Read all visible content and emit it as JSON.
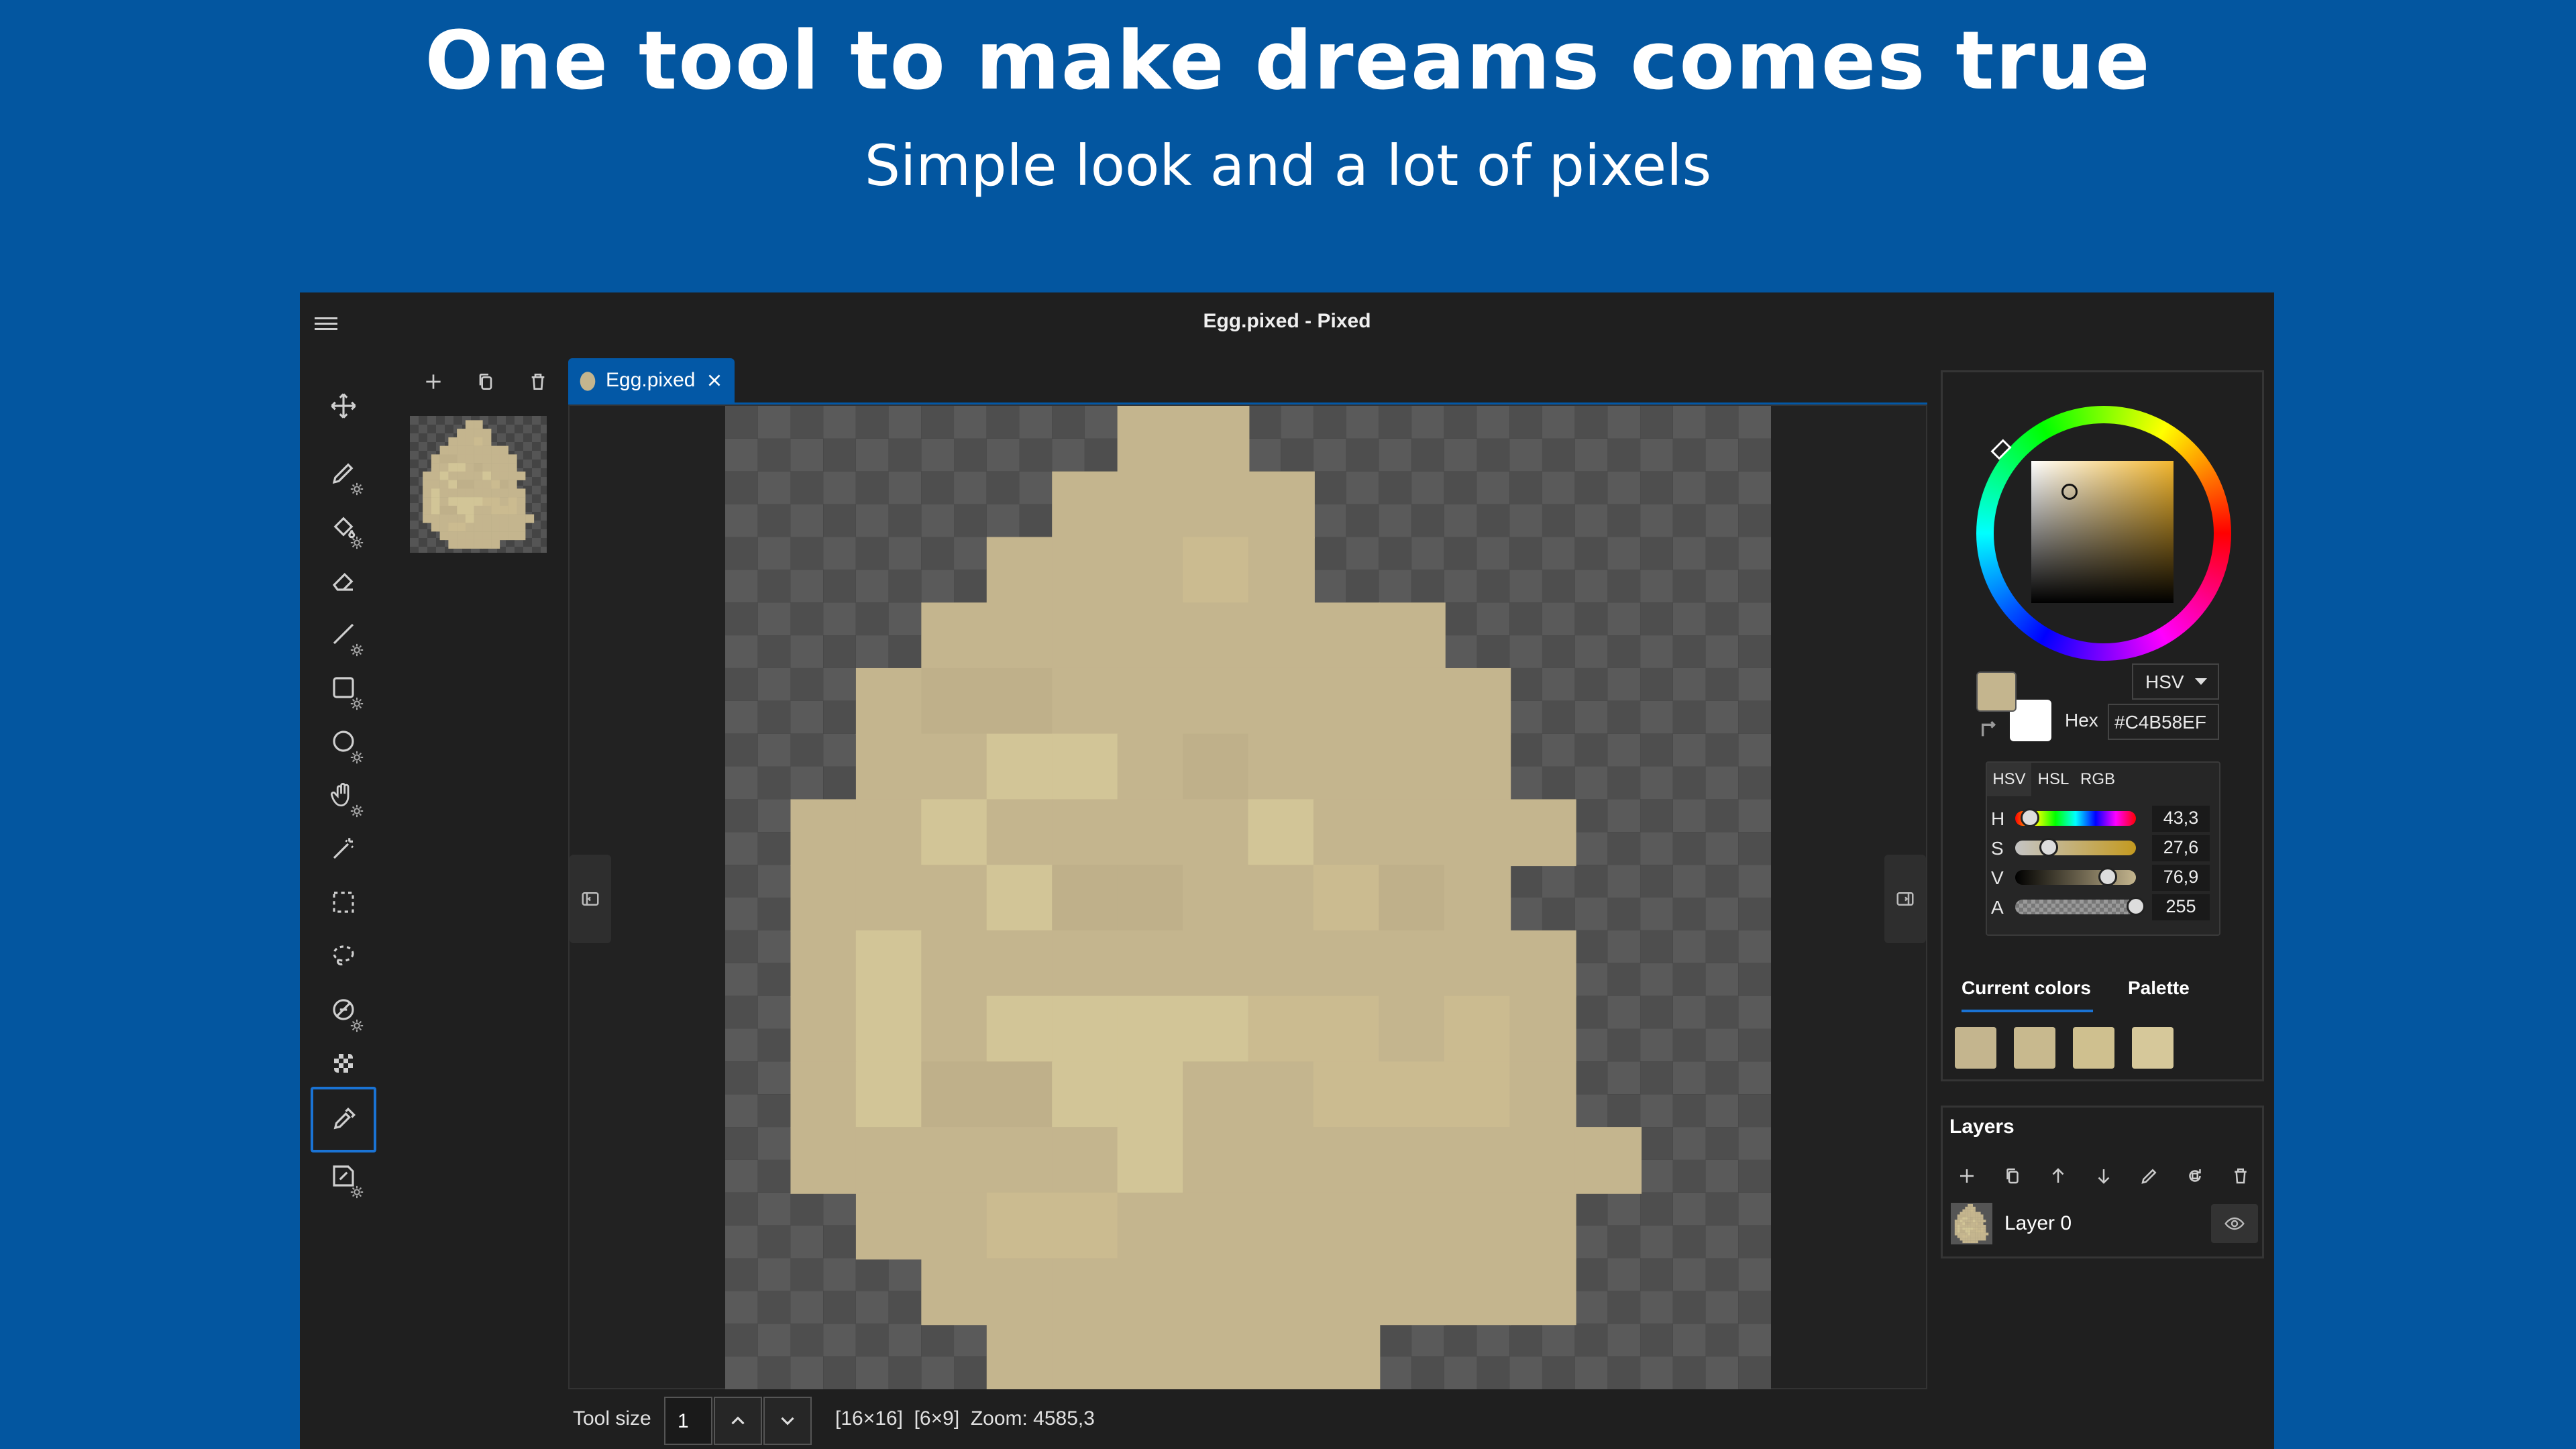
{
  "promo": {
    "headline": "One tool to make dreams comes true",
    "subheadline": "Simple look and a lot of pixels"
  },
  "window": {
    "title": "Egg.pixed - Pixed"
  },
  "toolbar": {
    "tools": [
      {
        "name": "move",
        "icon": "move-icon",
        "has_settings": false
      },
      {
        "name": "pencil",
        "icon": "pencil-icon",
        "has_settings": true
      },
      {
        "name": "fill",
        "icon": "paint-bucket-icon",
        "has_settings": true
      },
      {
        "name": "eraser",
        "icon": "eraser-icon",
        "has_settings": false
      },
      {
        "name": "line",
        "icon": "line-icon",
        "has_settings": true
      },
      {
        "name": "rectangle",
        "icon": "rectangle-icon",
        "has_settings": true
      },
      {
        "name": "ellipse",
        "icon": "ellipse-icon",
        "has_settings": true
      },
      {
        "name": "pan",
        "icon": "hand-icon",
        "has_settings": true
      },
      {
        "name": "magic-wand",
        "icon": "magic-wand-icon",
        "has_settings": false
      },
      {
        "name": "rect-select",
        "icon": "rect-select-icon",
        "has_settings": false
      },
      {
        "name": "lasso-select",
        "icon": "lasso-icon",
        "has_settings": false
      },
      {
        "name": "dither",
        "icon": "dither-icon",
        "has_settings": true
      },
      {
        "name": "checker",
        "icon": "checkerboard-icon",
        "has_settings": false
      },
      {
        "name": "color-picker",
        "icon": "eyedropper-icon",
        "has_settings": false,
        "active": true
      },
      {
        "name": "shade",
        "icon": "shade-icon",
        "has_settings": true
      }
    ]
  },
  "frames": {
    "buttons": [
      "add-frame",
      "duplicate-frame",
      "delete-frame"
    ]
  },
  "tab": {
    "label": "Egg.pixed"
  },
  "statusbar": {
    "tool_size_label": "Tool size",
    "tool_size_value": "1",
    "info": "[16×16]  [6×9]  Zoom: 4585,3"
  },
  "color": {
    "primary": "#c4b58e",
    "secondary": "#ffffff",
    "mode": "HSV",
    "hex_label": "Hex",
    "hex_value": "#C4B58EF",
    "mini_tabs": [
      "HSV",
      "HSL",
      "RGB"
    ],
    "sliders": [
      {
        "label": "H",
        "value": "43,3",
        "fraction": 0.12
      },
      {
        "label": "S",
        "value": "27,6",
        "fraction": 0.276
      },
      {
        "label": "V",
        "value": "76,9",
        "fraction": 0.769
      },
      {
        "label": "A",
        "value": "255",
        "fraction": 1.0
      }
    ],
    "tabs": [
      "Current colors",
      "Palette"
    ],
    "current_colors": [
      "#c4b58e",
      "#c8b98e",
      "#cfc08f",
      "#d6c89a"
    ]
  },
  "layers": {
    "title": "Layers",
    "items": [
      {
        "name": "Layer 0"
      }
    ]
  },
  "sprite": {
    "palette": [
      "#c4b58e",
      "#d2c597",
      "#bfb08a",
      "#cbbb90"
    ],
    "rows": [
      "......00........",
      ".....0000.......",
      "....00030.......",
      "...00000000.....",
      "..0220000000....",
      "..0011020000....",
      ".001000010000...",
      ".00012200320....",
      ".010000000000...",
      ".010111133030...",
      ".012211003330...",
      ".0000010000000..",
      "..00330000000...",
      "...0000000000...",
      "....000000......"
    ]
  }
}
